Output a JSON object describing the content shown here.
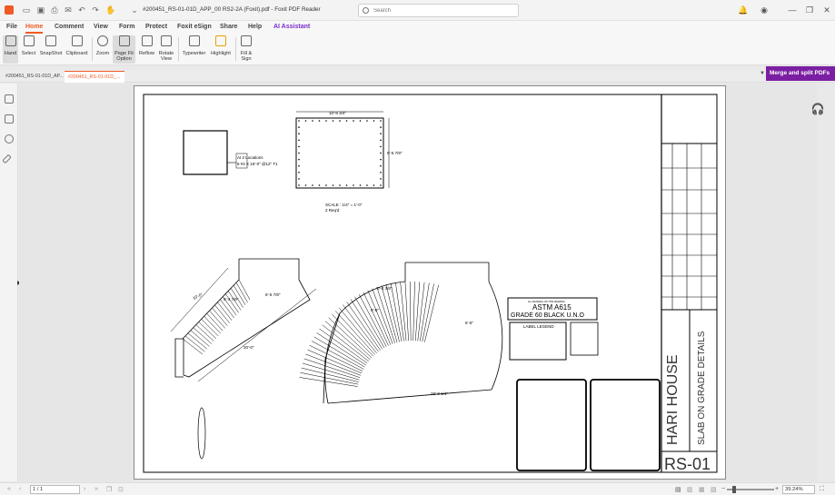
{
  "window": {
    "title": "#200451_RS-01-01D_APP_00 RS2-2A (Foxit).pdf - Foxit PDF Reader",
    "search_placeholder": "Search"
  },
  "menu": {
    "file": "File",
    "home": "Home",
    "comment": "Comment",
    "view": "View",
    "form": "Form",
    "protect": "Protect",
    "esign": "Foxit eSign",
    "share": "Share",
    "help": "Help",
    "ai": "AI Assistant"
  },
  "ribbon": {
    "hand": "Hand",
    "select": "Select",
    "snapshot": "SnapShot",
    "clipboard": "Clipboard",
    "zoom": "Zoom",
    "page_fit_1": "Page Fit",
    "page_fit_2": "Option",
    "reflow": "Reflow",
    "rotate_1": "Rotate",
    "rotate_2": "View",
    "typewriter": "Typewriter",
    "highlight": "Highlight",
    "fill_sign_1": "Fill &",
    "fill_sign_2": "Sign"
  },
  "tabs": {
    "tab1": "#200451_RS-01-01D_AP...",
    "tab2": "#200451_RS-01-01D_..."
  },
  "merge_button": "Merge and split PDFs",
  "status": {
    "page": "1 / 1",
    "zoom": "39.24%"
  },
  "drawing": {
    "top_dim": "10'-8 3/4\"",
    "right_dim": "8'-5 7/8\"",
    "scale": "SCALE : 1/4\" = 1'-0\"",
    "reqd": "2 Req'd",
    "note1": "At 2 Locations",
    "note2": "6 #4 X 16'-0\" @12\" T1",
    "left_dim1": "10'-0\"",
    "left_dim2": "6'-4 7/8\"",
    "left_dim3": "6'-5 7/8\"",
    "left_dim4": "20'-0\"",
    "center_dim1": "0'-4 3/8\"",
    "center_dim2": "0'-0\"",
    "center_dim3": "6'-5\"",
    "center_dim4": "28'-0 1/4\"",
    "astm_small": "ALL MATERIAL ON THIS DRAWING",
    "astm": "ASTM A615",
    "grade": "GRADE 60 BLACK U.N.O",
    "legend": "LABEL LEGEND",
    "project": "HARI HOUSE",
    "sheet_title": "SLAB ON GRADE DETAILS",
    "sheet_no": "RS-01"
  }
}
